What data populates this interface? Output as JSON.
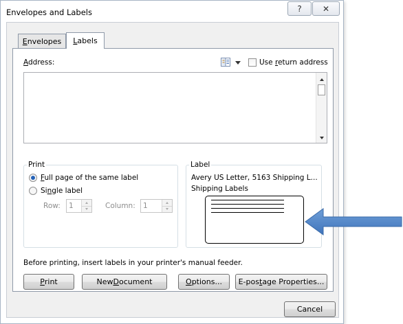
{
  "window": {
    "title": "Envelopes and Labels",
    "help_glyph": "?",
    "close_glyph": "✕"
  },
  "tabs": [
    {
      "label": "Envelopes",
      "accel": "E",
      "rest": "nvelopes",
      "active": false
    },
    {
      "label": "Labels",
      "accel": "L",
      "rest": "abels",
      "active": true
    }
  ],
  "address": {
    "label_accel": "A",
    "label_rest": "ddress:",
    "value": "",
    "use_return_address": {
      "pre": "Use ",
      "accel": "r",
      "post": "eturn address",
      "checked": false
    }
  },
  "print_group": {
    "title": "Print",
    "full_page": {
      "accel": "F",
      "rest": "ull page of the same label",
      "selected": true
    },
    "single_label": {
      "pre": "Si",
      "accel": "n",
      "post": "gle label",
      "selected": false
    },
    "row_label": "Row:",
    "row_value": "1",
    "column_label": "Column:",
    "column_value": "1"
  },
  "label_group": {
    "title": "Label",
    "name": "Avery US Letter, 5163 Shipping L...",
    "type": "Shipping Labels"
  },
  "hint": "Before printing, insert labels in your printer's manual feeder.",
  "buttons": {
    "print": {
      "accel": "P",
      "rest": "rint"
    },
    "new_document": {
      "pre": "New ",
      "accel": "D",
      "rest": "ocument"
    },
    "options": {
      "accel": "O",
      "rest": "ptions..."
    },
    "epostage": {
      "pre": "E-pos",
      "accel": "t",
      "rest": "age Properties..."
    },
    "cancel": "Cancel"
  },
  "colors": {
    "arrow": "#4a7fc3",
    "radio_dot": "#2461b6"
  }
}
